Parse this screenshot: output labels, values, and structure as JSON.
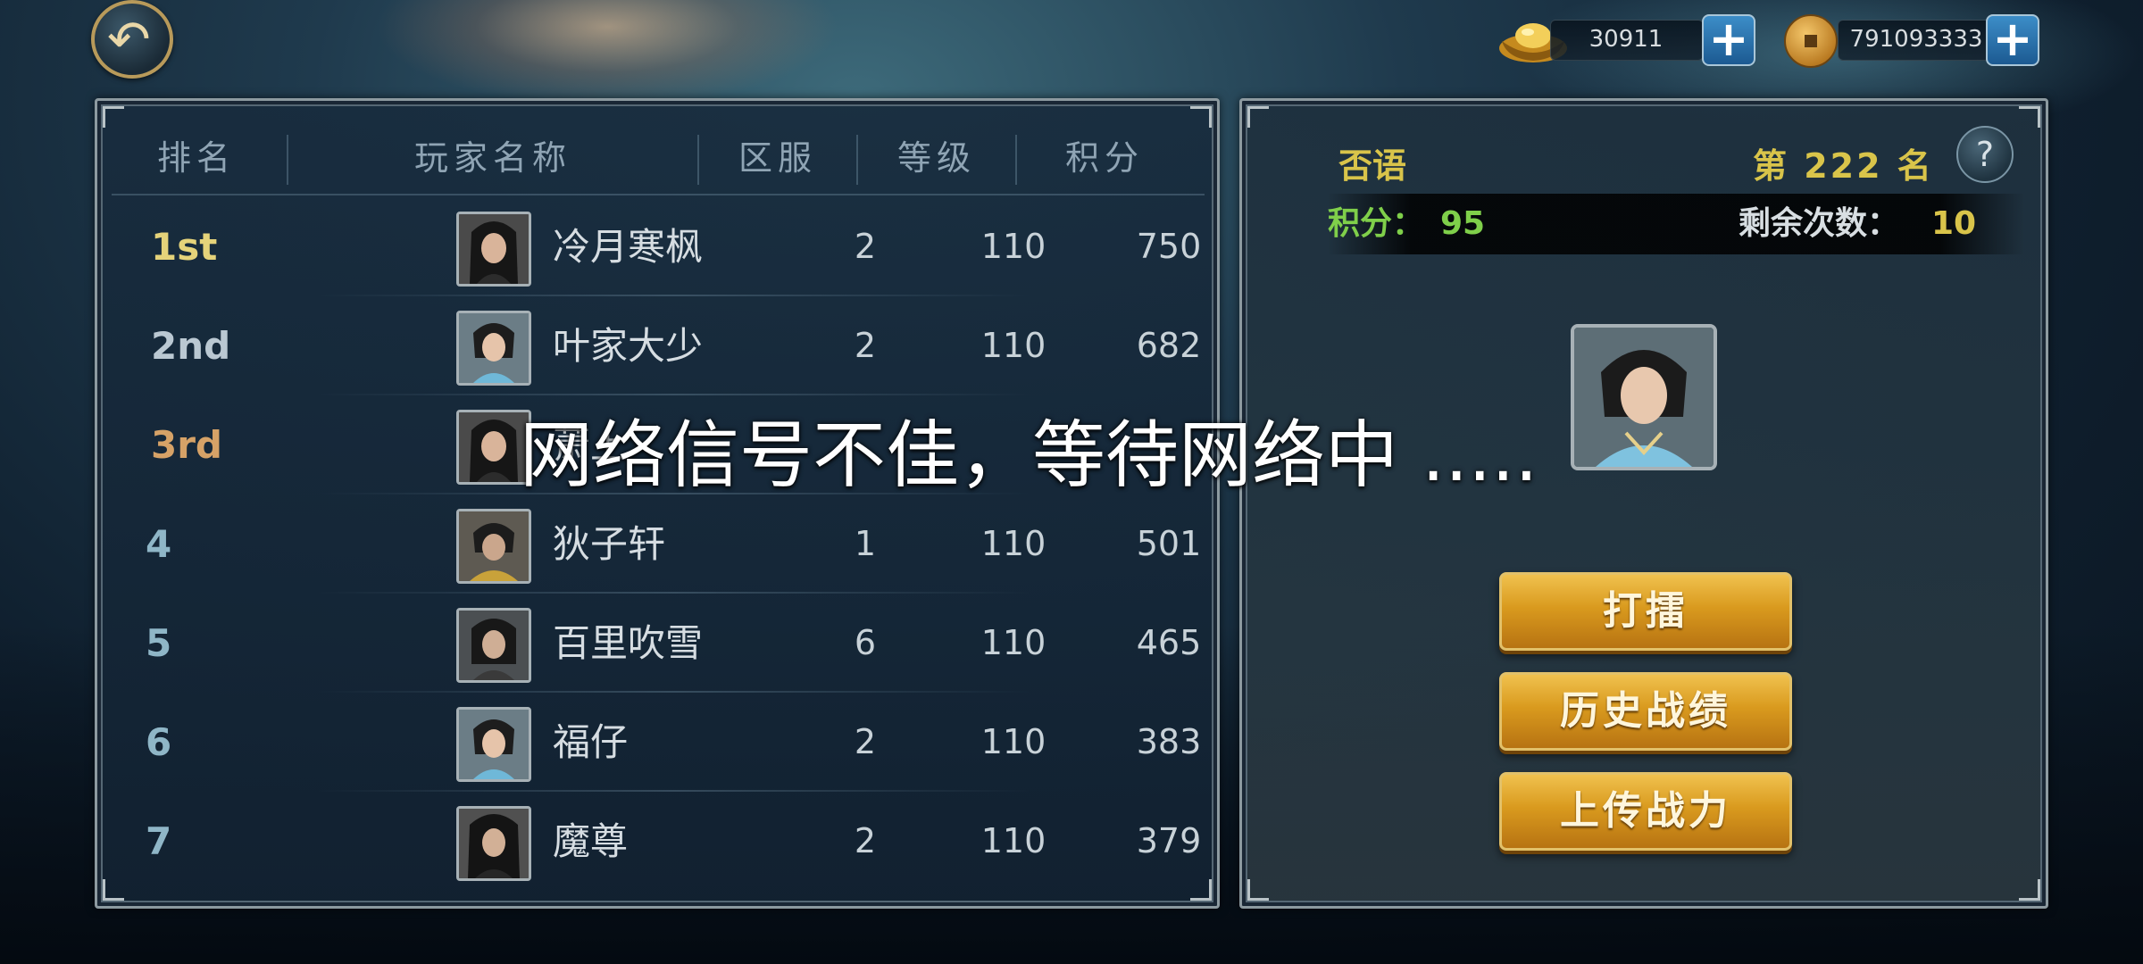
{
  "currency": {
    "ingot": {
      "icon": "gold-ingot-icon",
      "value": "30911"
    },
    "coin": {
      "icon": "copper-coin-icon",
      "value": "791093333"
    }
  },
  "ranking": {
    "headers": [
      "排名",
      "玩家名称",
      "区服",
      "等级",
      "积分"
    ],
    "rows": [
      {
        "rank": "1st",
        "name": "冷月寒枫",
        "server": "2",
        "level": "110",
        "score": "750"
      },
      {
        "rank": "2nd",
        "name": "叶家大少",
        "server": "2",
        "level": "110",
        "score": "682"
      },
      {
        "rank": "3rd",
        "name": "萧上",
        "server": "",
        "level": "",
        "score": ""
      },
      {
        "rank": "4",
        "name": "狄子轩",
        "server": "1",
        "level": "110",
        "score": "501"
      },
      {
        "rank": "5",
        "name": "百里吹雪",
        "server": "6",
        "level": "110",
        "score": "465"
      },
      {
        "rank": "6",
        "name": "福仔",
        "server": "2",
        "level": "110",
        "score": "383"
      },
      {
        "rank": "7",
        "name": "魔尊",
        "server": "2",
        "level": "110",
        "score": "379"
      }
    ]
  },
  "player": {
    "name": "否语",
    "rank_text": "第 222 名",
    "score_label": "积分：",
    "score_value": "95",
    "remaining_label": "剩余次数：",
    "remaining_value": "10",
    "help": "?"
  },
  "buttons": {
    "fight": "打擂",
    "history": "历史战绩",
    "upload": "上传战力"
  },
  "overlay": {
    "message": "网络信号不佳，等待网络中 ....."
  },
  "colors": {
    "gold_text": "#d9c44a",
    "green_text": "#7fcf4a",
    "button_gold": "#d99a1e",
    "plus_blue": "#2a78b4"
  }
}
